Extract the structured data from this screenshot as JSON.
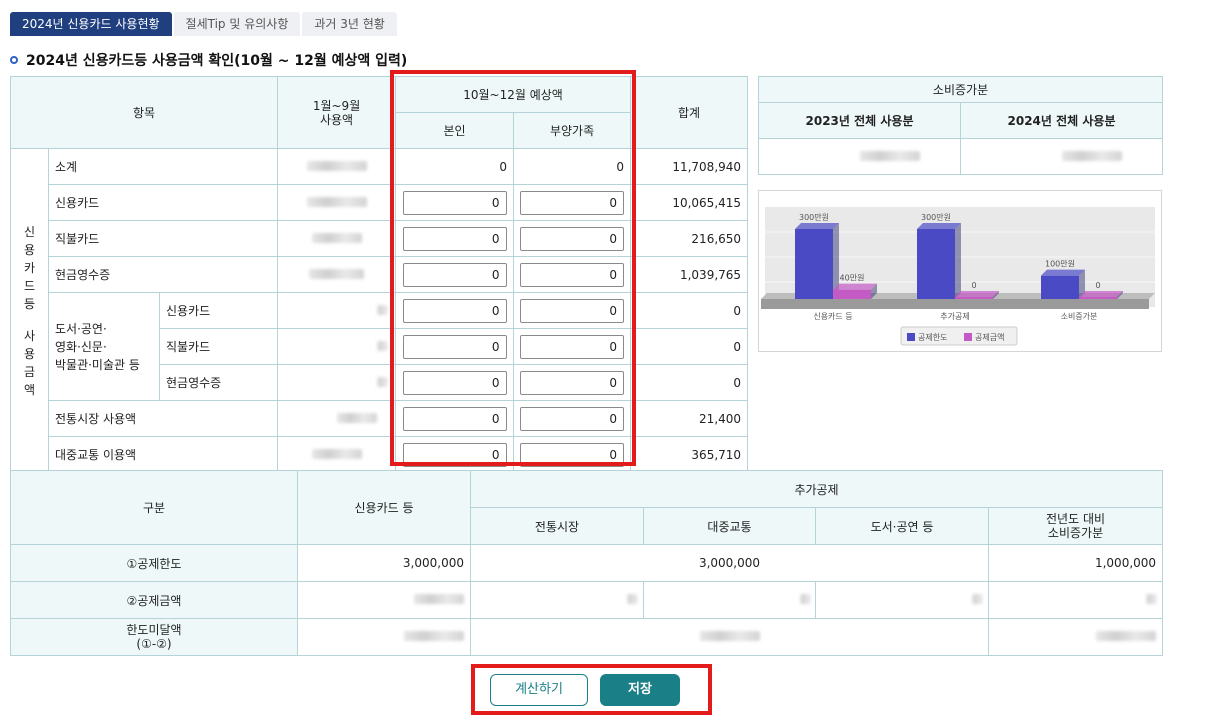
{
  "tabs": [
    "2024년 신용카드 사용현황",
    "절세Tip 및 유의사항",
    "과거 3년 현황"
  ],
  "section_title": "2024년 신용카드등 사용금액 확인(10월 ~ 12월 예상액 입력)",
  "main_table": {
    "col_item": "항목",
    "col_jan_sep": "1월~9월\n사용액",
    "col_oct_dec": "10월~12월 예상액",
    "col_self": "본인",
    "col_dependent": "부양가족",
    "col_total": "합계",
    "side_label": [
      "신",
      "용",
      "카",
      "드",
      "등",
      "",
      "사",
      "용",
      "금",
      "액"
    ],
    "subgroup_label": "도서·공연·\n영화·신문·\n박물관·미술관 등",
    "rows": [
      {
        "label": "소계",
        "self": "0",
        "dependent": "0",
        "total": "11,708,940",
        "editable": false
      },
      {
        "label": "신용카드",
        "self": "0",
        "dependent": "0",
        "total": "10,065,415",
        "editable": true
      },
      {
        "label": "직불카드",
        "self": "0",
        "dependent": "0",
        "total": "216,650",
        "editable": true
      },
      {
        "label": "현금영수증",
        "self": "0",
        "dependent": "0",
        "total": "1,039,765",
        "editable": true
      },
      {
        "label": "신용카드",
        "self": "0",
        "dependent": "0",
        "total": "0",
        "editable": true
      },
      {
        "label": "직불카드",
        "self": "0",
        "dependent": "0",
        "total": "0",
        "editable": true
      },
      {
        "label": "현금영수증",
        "self": "0",
        "dependent": "0",
        "total": "0",
        "editable": true
      },
      {
        "label": "전통시장 사용액",
        "self": "0",
        "dependent": "0",
        "total": "21,400",
        "editable": true
      },
      {
        "label": "대중교통 이용액",
        "self": "0",
        "dependent": "0",
        "total": "365,710",
        "editable": true
      }
    ]
  },
  "increase_table": {
    "title": "소비증가분",
    "col_2023": "2023년 전체 사용분",
    "col_2024": "2024년 전체 사용분"
  },
  "chart_data": {
    "type": "bar",
    "categories": [
      "신용카드 등",
      "추가공제",
      "소비증가분"
    ],
    "series": [
      {
        "name": "공제한도",
        "values": [
          300,
          300,
          100
        ],
        "labels": [
          "300만원",
          "300만원",
          "100만원"
        ],
        "color": "#4a4ac4"
      },
      {
        "name": "공제금액",
        "values": [
          40,
          0,
          0
        ],
        "labels": [
          "40만원",
          "0",
          "0"
        ],
        "color": "#c45ac4"
      }
    ],
    "ylim": [
      0,
      300
    ],
    "legend": "bottom"
  },
  "bottom_table": {
    "col_category": "구분",
    "col_credit": "신용카드 등",
    "col_additional": "추가공제",
    "col_market": "전통시장",
    "col_transit": "대중교통",
    "col_culture": "도서·공연 등",
    "col_increase": "전년도 대비\n소비증가분",
    "row1_label": "①공제한도",
    "row1_credit": "3,000,000",
    "row1_additional": "3,000,000",
    "row1_increase": "1,000,000",
    "row2_label": "②공제금액",
    "row3_label": "한도미달액\n(①-②)"
  },
  "buttons": {
    "calculate": "계산하기",
    "save": "저장"
  },
  "colors": {
    "accent": "#1b7f87",
    "tab_active": "#1f3f7f",
    "highlight": "#e31b1b",
    "header_bg": "#eef8f8"
  }
}
